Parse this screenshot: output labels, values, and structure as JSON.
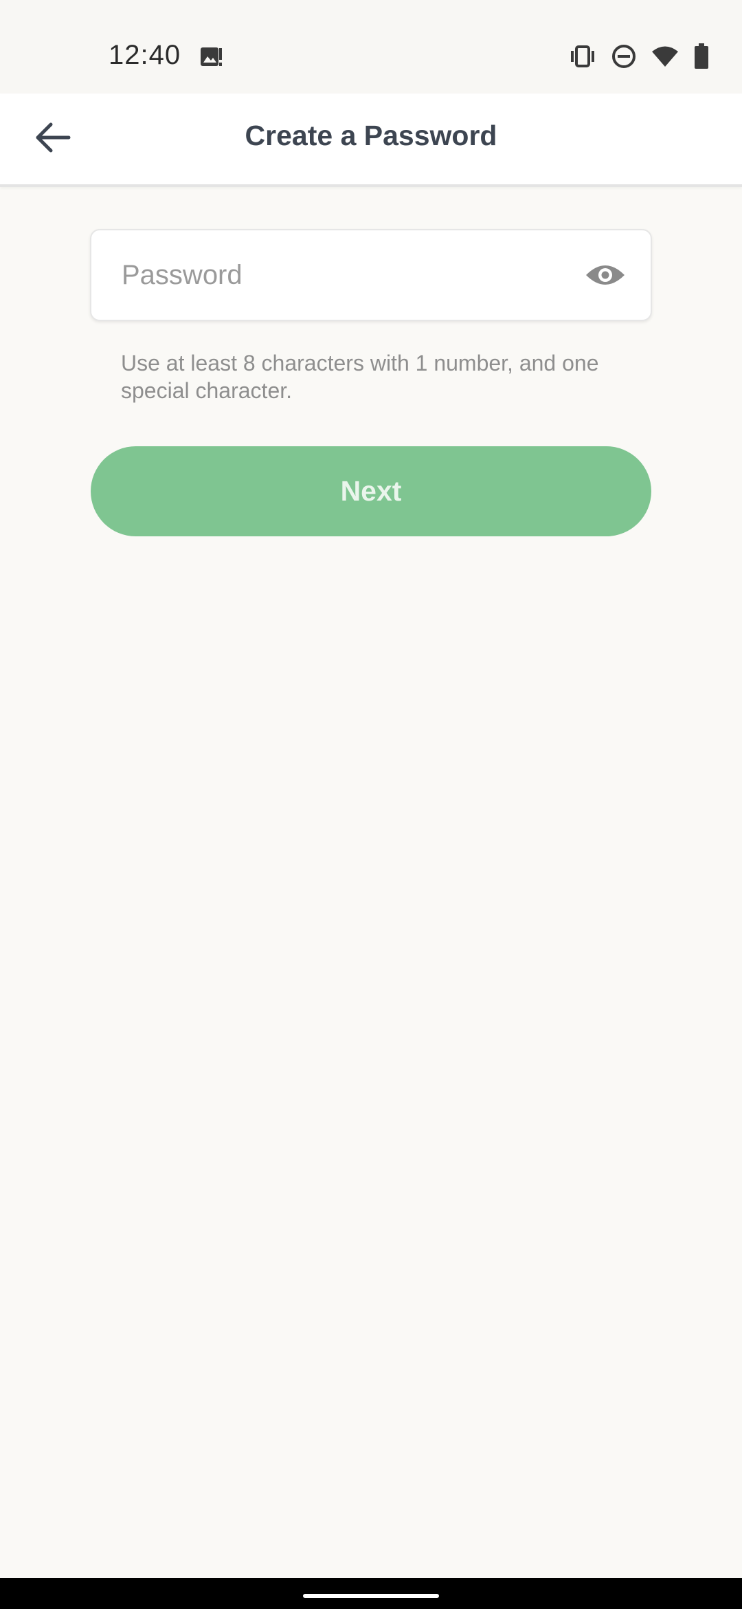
{
  "status_bar": {
    "time": "12:40",
    "notification_icon": "image-alert-icon",
    "right_icons": [
      "vibrate-icon",
      "do-not-disturb-icon",
      "wifi-icon",
      "battery-icon"
    ]
  },
  "app_bar": {
    "back_icon": "arrow-left-icon",
    "title": "Create a Password"
  },
  "password_field": {
    "value": "",
    "placeholder": "Password",
    "toggle_icon": "eye-icon"
  },
  "helper_text": "Use at least 8 characters with 1 number, and one special character.",
  "next_button": {
    "label": "Next"
  },
  "colors": {
    "background": "#FAF9F6",
    "title": "#3D4551",
    "button": "#7FC591",
    "button_text": "#EAF5EC",
    "helper": "#8E8E8E"
  }
}
